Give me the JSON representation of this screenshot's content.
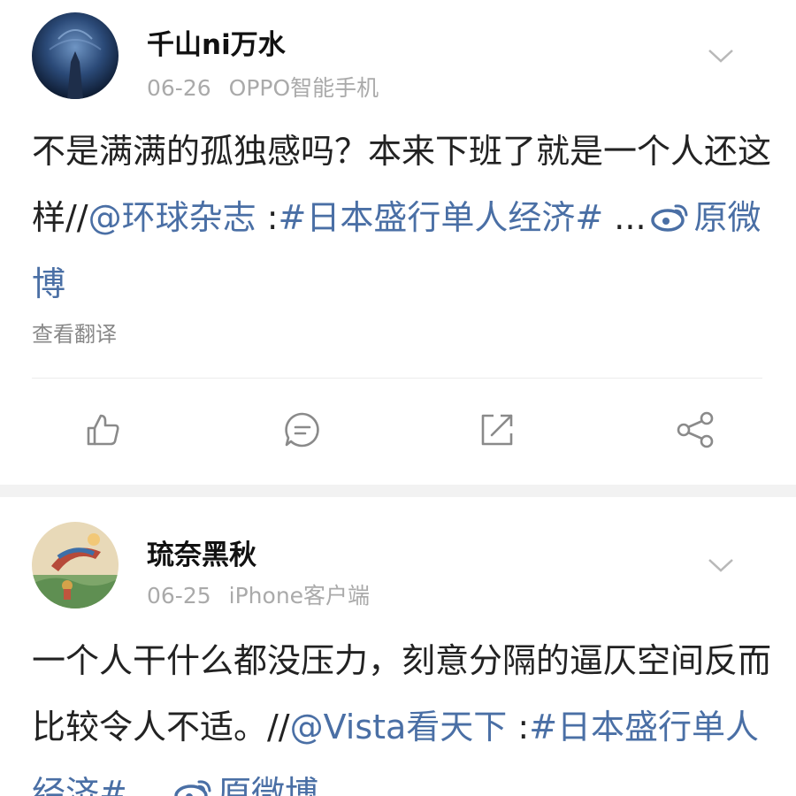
{
  "posts": [
    {
      "username": "千山ni万水",
      "date": "06-26",
      "source": "OPPO智能手机",
      "body_text": "不是满满的孤独感吗？本来下班了就是一个人还这样//",
      "mention": "@环球杂志",
      "sep": " :",
      "hashtag": "#日本盛行单人经济#",
      "ellipsis": " ...",
      "original_link": "原微博",
      "translate_label": "查看翻译",
      "actions": [
        "like-icon",
        "comment-icon",
        "repost-icon",
        "share-icon"
      ],
      "menu_icon": "chevron-down-icon"
    },
    {
      "username": "琉奈黑秋",
      "date": "06-25",
      "source": "iPhone客户端",
      "body_text": "一个人干什么都没压力，刻意分隔的逼仄空间反而比较令人不适。//",
      "mention": "@Vista看天下",
      "sep": " :",
      "hashtag": "#日本盛行单人经济#",
      "ellipsis": " ...",
      "original_link": "原微博",
      "menu_icon": "chevron-down-icon"
    }
  ],
  "colors": {
    "link": "#4a6fa5",
    "meta": "#aaaaaa",
    "icon": "#8a8a8a",
    "separator": "#f2f2f2"
  }
}
